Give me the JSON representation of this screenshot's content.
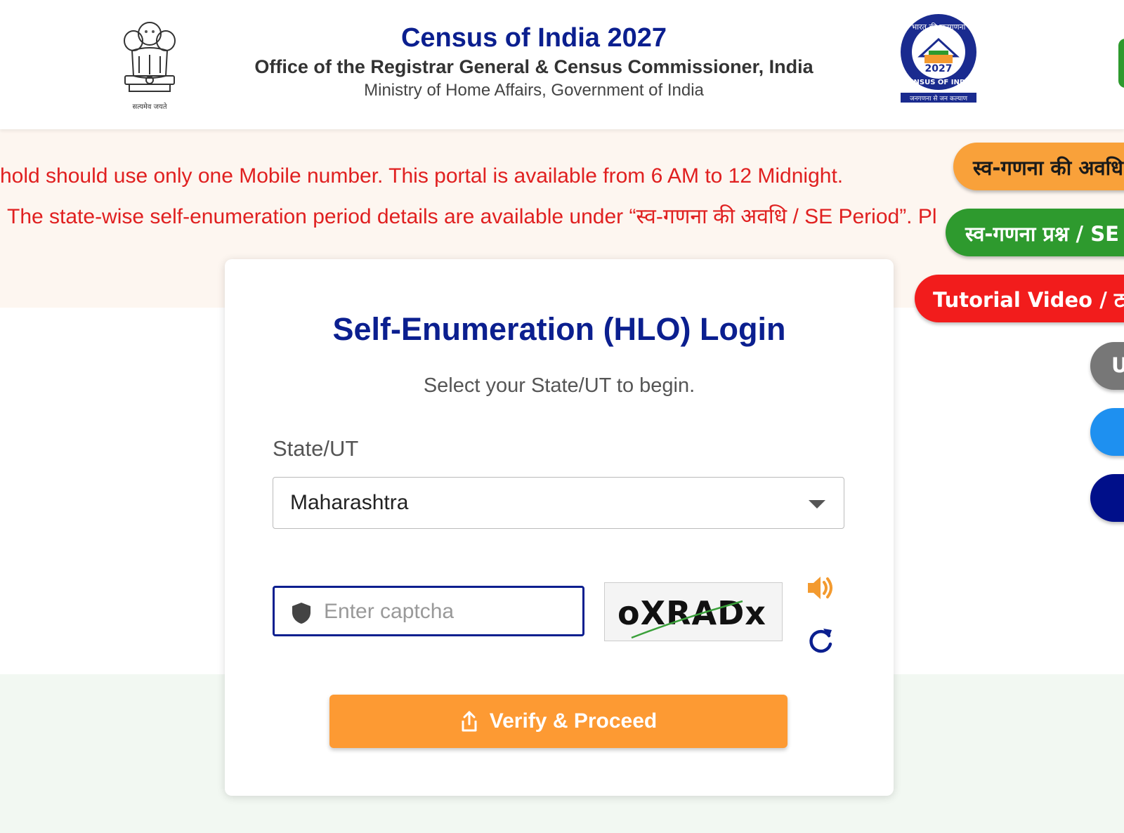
{
  "header": {
    "emblem_caption": "सत्यमेव जयते",
    "title": "Census of India 2027",
    "subtitle": "Office of the Registrar General & Census Commissioner, India",
    "ministry": "Ministry of Home Affairs, Government of India",
    "logo": {
      "top_text": "भारत की जनगणना",
      "year": "2027",
      "ring_text": "CENSUS OF INDIA",
      "tagline": "जनगणना से जन कल्याण"
    }
  },
  "notice": {
    "line1": "hold should use only one Mobile number. This portal is available from 6 AM to 12 Midnight.",
    "line2": "The state-wise self-enumeration period details are available under “स्व-गणना की अवधि / SE Period”. Pl"
  },
  "side_buttons": {
    "se_period": "स्व-गणना की अवधि / SE Period",
    "se_questions": "स्व-गणना प्रश्न / SE Questions",
    "tutorial": "Tutorial Video / ट्यूटोरियल वीडियो",
    "gray_initial": "U"
  },
  "login": {
    "title": "Self-Enumeration (HLO) Login",
    "subtitle": "Select your State/UT to begin.",
    "state_label": "State/UT",
    "state_value": "Maharashtra",
    "captcha_placeholder": "Enter captcha",
    "captcha_text": "oXRADx",
    "verify_label": "Verify & Proceed"
  },
  "colors": {
    "title_blue": "#0b1f8f",
    "notice_red": "#e02020",
    "verify_orange": "#fd9a33",
    "green": "#2e9a2e",
    "red": "#f21c1c"
  },
  "icons": [
    "national-emblem-icon",
    "census-logo-icon",
    "shield-icon",
    "speaker-icon",
    "refresh-icon",
    "share-icon",
    "chevron-down-icon"
  ]
}
